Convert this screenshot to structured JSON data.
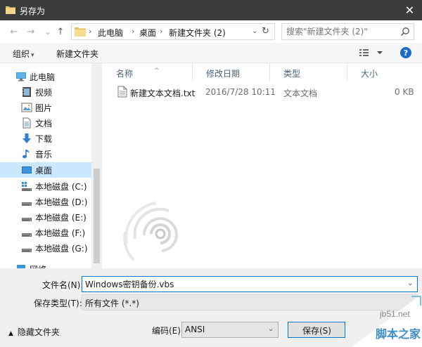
{
  "window": {
    "title": "另存为",
    "close_label": "✕"
  },
  "nav": {
    "back": "←",
    "forward": "→",
    "recent": "⌄",
    "up": "↑",
    "breadcrumb": [
      "此电脑",
      "桌面",
      "新建文件夹 (2)"
    ],
    "search_placeholder": "搜索\"新建文件夹 (2)\""
  },
  "toolbar": {
    "organize": "组织",
    "new_folder": "新建文件夹",
    "help": "?"
  },
  "sidebar": {
    "items": [
      {
        "label": "此电脑",
        "icon": "computer-icon"
      },
      {
        "label": "视频",
        "icon": "video-icon"
      },
      {
        "label": "图片",
        "icon": "picture-icon"
      },
      {
        "label": "文档",
        "icon": "document-icon"
      },
      {
        "label": "下载",
        "icon": "download-icon"
      },
      {
        "label": "音乐",
        "icon": "music-icon"
      },
      {
        "label": "桌面",
        "icon": "desktop-icon",
        "selected": true
      },
      {
        "label": "本地磁盘 (C:)",
        "icon": "system-drive-icon"
      },
      {
        "label": "本地磁盘 (D:)",
        "icon": "drive-icon"
      },
      {
        "label": "本地磁盘 (E:)",
        "icon": "drive-icon"
      },
      {
        "label": "本地磁盘 (F:)",
        "icon": "drive-icon"
      },
      {
        "label": "本地磁盘 (G:)",
        "icon": "drive-icon"
      },
      {
        "label": "网络",
        "icon": "network-icon"
      }
    ]
  },
  "filelist": {
    "columns": [
      "名称",
      "修改日期",
      "类型",
      "大小"
    ],
    "rows": [
      {
        "name": "新建文本文档.txt",
        "date": "2016/7/28 10:11",
        "type": "文本文档",
        "size": "0 KB"
      }
    ]
  },
  "bottom": {
    "filename_label": "文件名(N):",
    "filename_value": "Windows密钥备份.vbs",
    "filetype_label": "保存类型(T):",
    "filetype_value": "所有文件  (*.*)",
    "hide_folders": "隐藏文件夹",
    "encoding_label": "编码(E):",
    "encoding_value": "ANSI",
    "save_button": "保存(S)"
  },
  "watermark": {
    "site": "jb51.net",
    "brand": "脚本之家"
  },
  "colors": {
    "accent": "#0078d7",
    "selected": "#cce8ff",
    "titlebar": "#3c3c3c",
    "help": "#1b6ac9"
  }
}
